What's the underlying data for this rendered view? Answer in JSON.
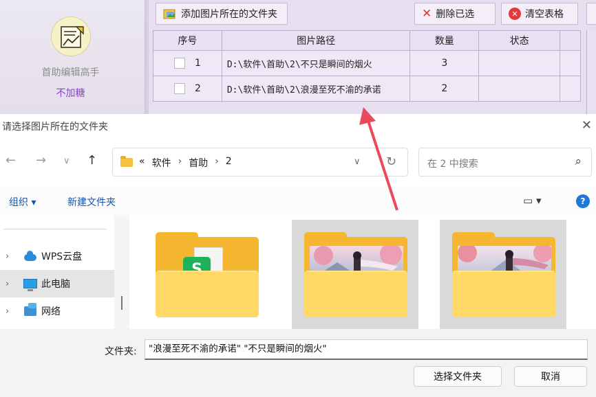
{
  "app": {
    "name": "首助编辑高手",
    "tag": "不加糖",
    "toolbar": {
      "add_label": "添加图片所在的文件夹",
      "delete_label": "删除已选",
      "clear_label": "清空表格"
    },
    "table": {
      "headers": [
        "序号",
        "图片路径",
        "数量",
        "状态"
      ],
      "rows": [
        {
          "index": "1",
          "path": "D:\\软件\\首助\\2\\不只是瞬间的烟火",
          "count": "3",
          "status": ""
        },
        {
          "index": "2",
          "path": "D:\\软件\\首助\\2\\浪漫至死不渝的承诺",
          "count": "2",
          "status": ""
        }
      ]
    }
  },
  "dialog": {
    "title": "请选择图片所在的文件夹",
    "address": {
      "prefix": "«",
      "crumbs": [
        "软件",
        "首助",
        "2"
      ],
      "separator": "›"
    },
    "search_placeholder": "在 2 中搜索",
    "commands": {
      "organize": "组织 ▾",
      "new_folder": "新建文件夹"
    },
    "nav": [
      {
        "label": "WPS云盘",
        "icon": "cloud-icon",
        "selected": false
      },
      {
        "label": "此电脑",
        "icon": "computer-icon",
        "selected": true
      },
      {
        "label": "网络",
        "icon": "network-icon",
        "selected": false
      }
    ],
    "files": [
      {
        "kind": "wps",
        "selected": false
      },
      {
        "kind": "image-folder",
        "selected": true
      },
      {
        "kind": "image-folder",
        "selected": true
      }
    ],
    "filename_label": "文件夹:",
    "filename_value": "\"浪漫至死不渝的承诺\" \"不只是瞬间的烟火\"",
    "ok_label": "选择文件夹",
    "cancel_label": "取消"
  },
  "colors": {
    "app_bg": "#e7dff0",
    "tag_purple": "#8e3fd6",
    "link_blue": "#1a55a8",
    "folder_yellow": "#f4b72f",
    "annotation_arrow": "#ea4a5a"
  }
}
